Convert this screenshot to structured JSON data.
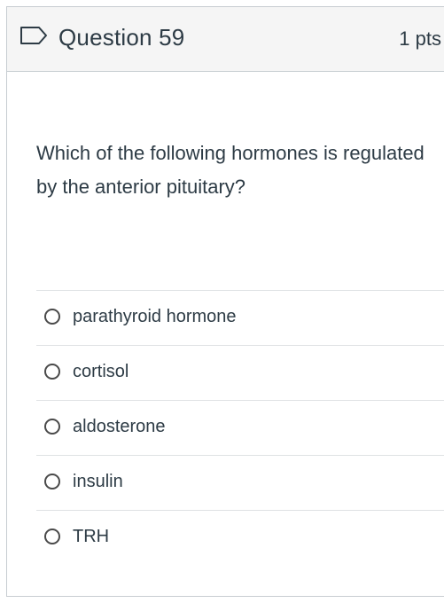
{
  "header": {
    "title": "Question 59",
    "points": "1 pts",
    "flag_icon": "flag-outline-icon"
  },
  "question": {
    "text": "Which of the following hormones is regulated by the anterior pituitary?"
  },
  "answers": [
    {
      "label": "parathyroid hormone",
      "selected": false
    },
    {
      "label": "cortisol",
      "selected": false
    },
    {
      "label": "aldosterone",
      "selected": false
    },
    {
      "label": "insulin",
      "selected": false
    },
    {
      "label": "TRH",
      "selected": false
    }
  ]
}
